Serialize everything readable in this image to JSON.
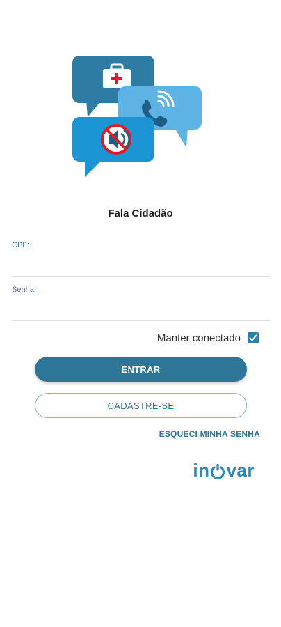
{
  "app": {
    "title": "Fala Cidadão"
  },
  "form": {
    "cpf_label": "CPF:",
    "cpf_value": "",
    "senha_label": "Senha:",
    "senha_value": "",
    "keep_connected_label": "Manter conectado",
    "keep_connected_checked": true
  },
  "actions": {
    "login_label": "ENTRAR",
    "register_label": "CADASTRE-SE",
    "forgot_label": "ESQUECI MINHA SENHA"
  },
  "brand": {
    "part1": "in",
    "part2": "var"
  },
  "colors": {
    "primary": "#2d7697",
    "brand": "#2a8ab8",
    "bubble_dark": "#2e7ca4",
    "bubble_light": "#5db3e4",
    "bubble_mid": "#1c95d4",
    "danger": "#e21b23"
  },
  "icons": {
    "illustration": "chat-bubbles-health-phone-mute-icon",
    "checkbox": "checkmark-icon"
  }
}
